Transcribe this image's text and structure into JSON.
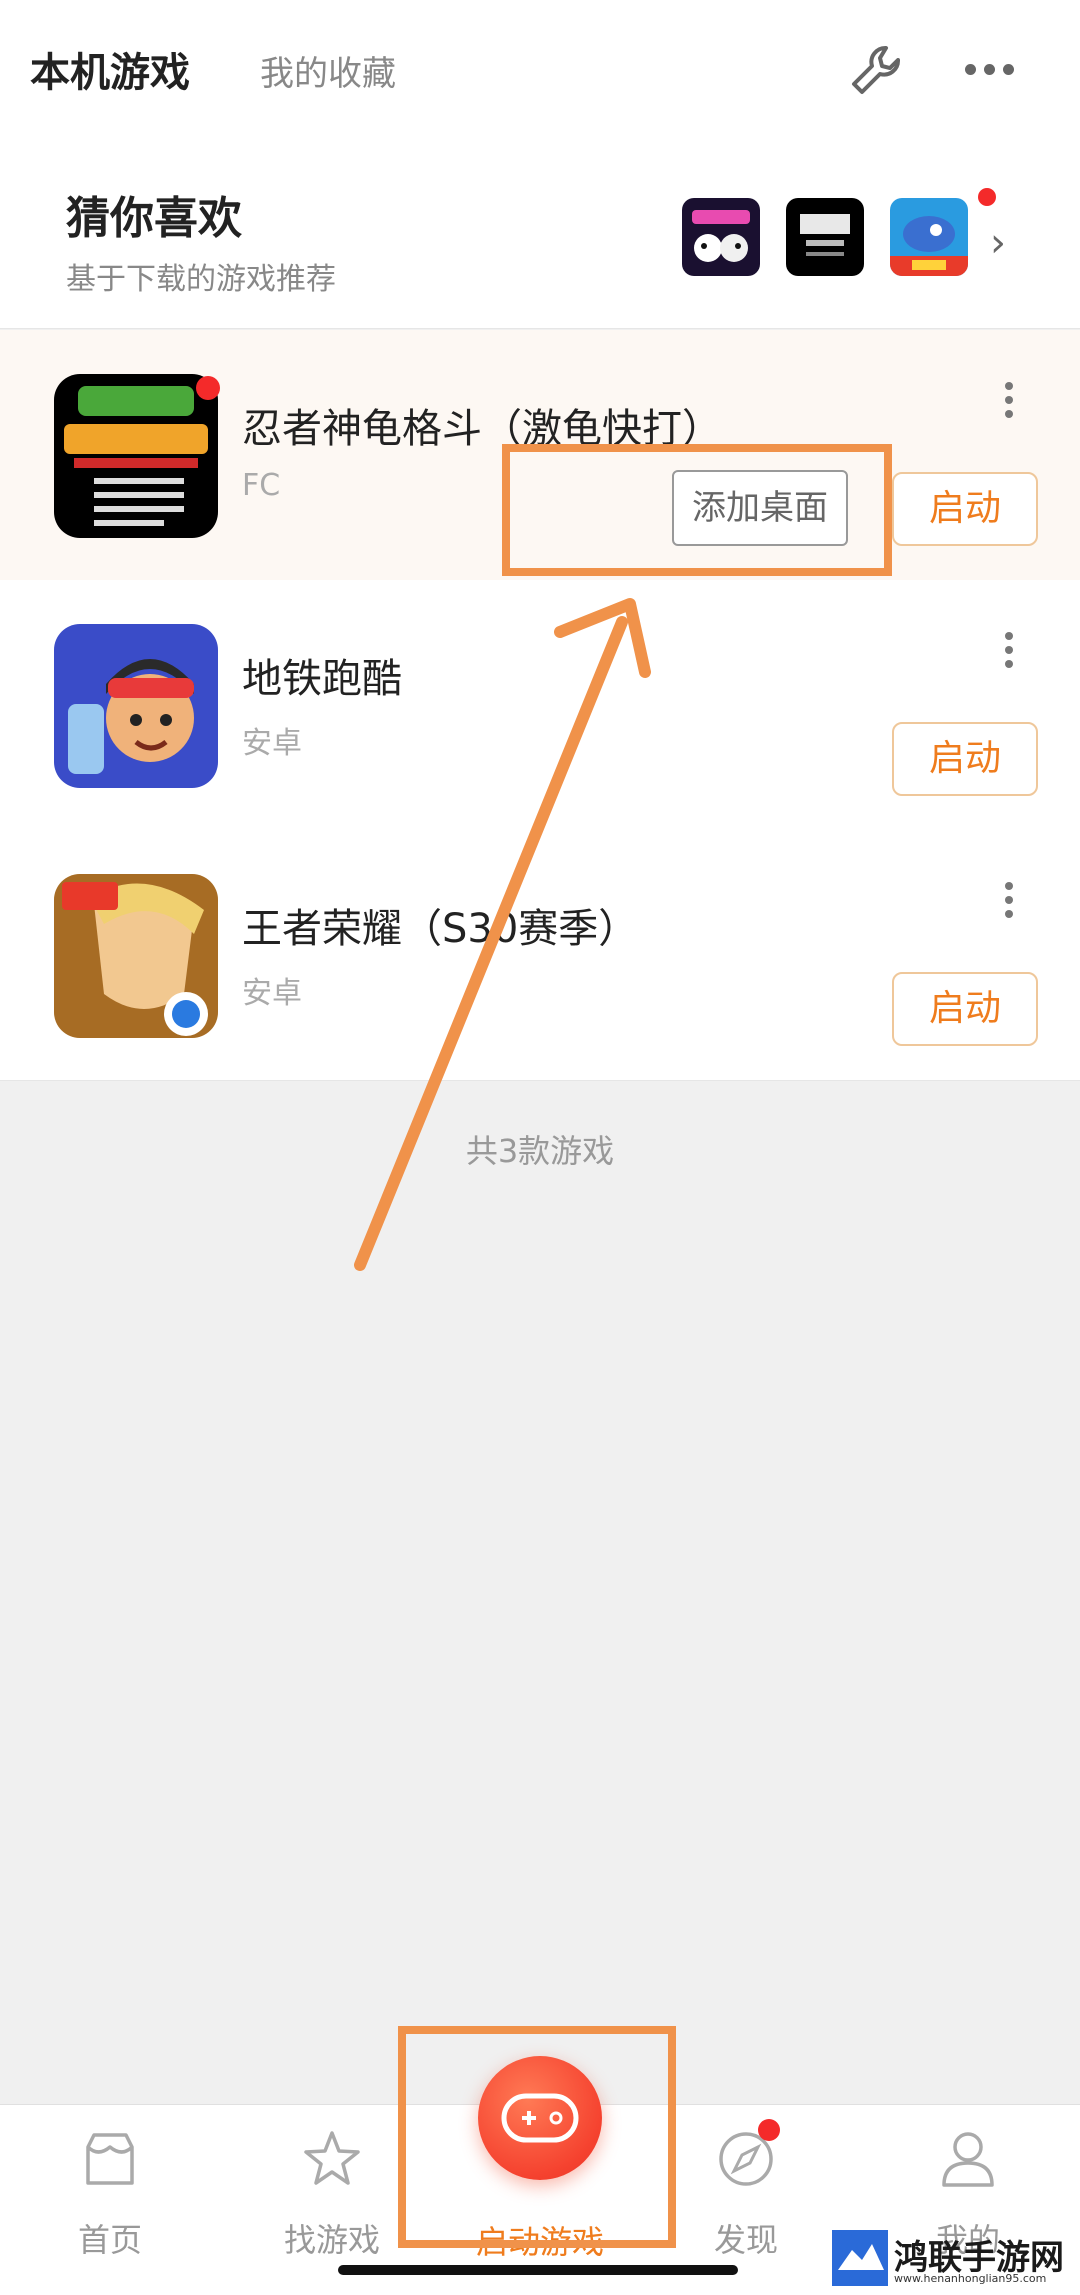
{
  "header": {
    "tab_active": "本机游戏",
    "tab_inactive": "我的收藏"
  },
  "guess": {
    "title": "猜你喜欢",
    "subtitle": "基于下载的游戏推荐"
  },
  "games": [
    {
      "name": "忍者神龟格斗（激龟快打）",
      "platform": "FC",
      "launch_label": "启动",
      "add_desktop_label": "添加桌面"
    },
    {
      "name": "地铁跑酷",
      "platform": "安卓",
      "launch_label": "启动"
    },
    {
      "name": "王者荣耀（S30赛季）",
      "platform": "安卓",
      "launch_label": "启动"
    }
  ],
  "summary": "共3款游戏",
  "nav": [
    "首页",
    "找游戏",
    "启动游戏",
    "发现",
    "我的"
  ],
  "watermark": {
    "text": "鸿联手游网",
    "url": "www.henanhonglian95.com"
  },
  "colors": {
    "accent": "#ef7c1d",
    "annotation": "#f0924a",
    "badge": "#f42a2a"
  }
}
